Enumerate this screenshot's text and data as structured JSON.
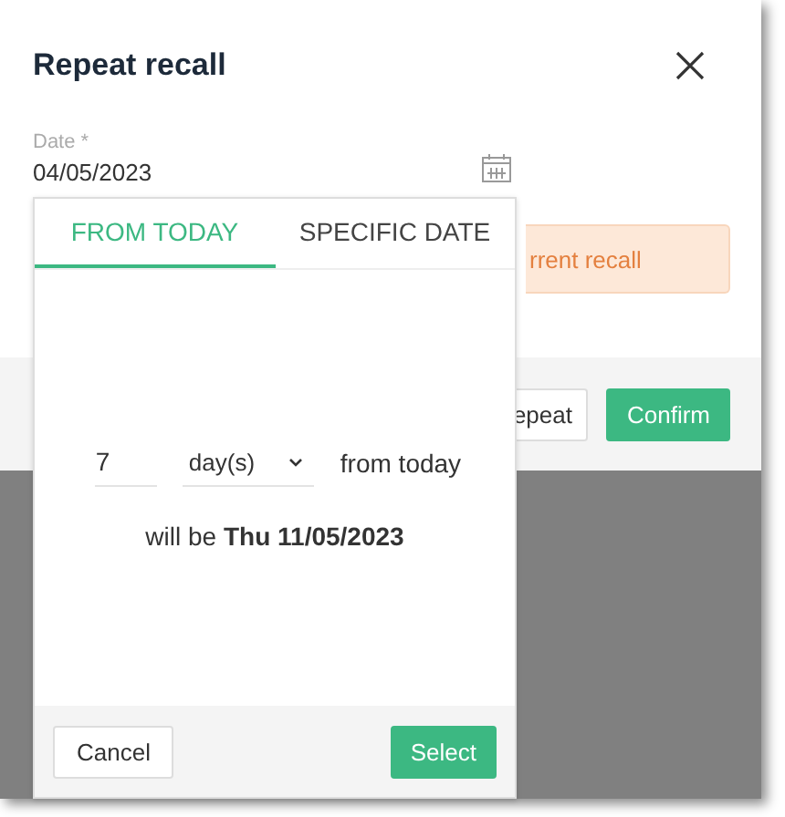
{
  "dialog": {
    "title": "Repeat recall",
    "date_field": {
      "label": "Date *",
      "value": "04/05/2023"
    },
    "alert": {
      "text": "rrent recall"
    },
    "buttons": [
      {
        "label": "epeat",
        "kind": "secondary"
      },
      {
        "label": "Confirm",
        "kind": "primary"
      }
    ]
  },
  "picker": {
    "tabs": [
      {
        "label": "FROM TODAY",
        "selected": true
      },
      {
        "label": "SPECIFIC DATE",
        "selected": false
      }
    ],
    "amount": {
      "value": "7"
    },
    "unit": {
      "value": "day(s)"
    },
    "suffix": "from today",
    "result": "will be **Thu 11/05/2023**",
    "buttons": [
      {
        "label": "Cancel",
        "kind": "secondary"
      },
      {
        "label": "Select",
        "kind": "primary"
      }
    ]
  }
}
